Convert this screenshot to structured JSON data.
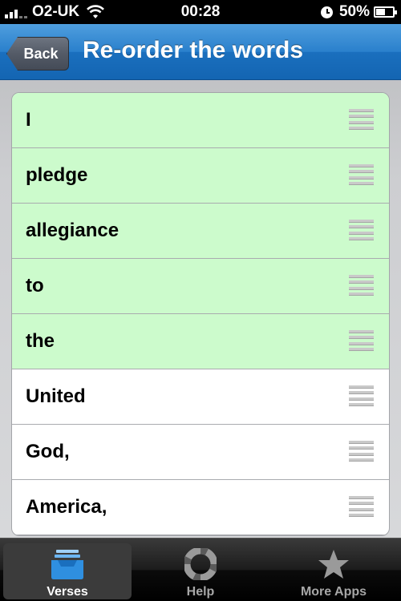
{
  "status_bar": {
    "carrier": "O2-UK",
    "time": "00:28",
    "battery": "50%"
  },
  "nav_bar": {
    "back_label": "Back",
    "title": "Re-order the words"
  },
  "words": [
    {
      "text": "I",
      "correct": true
    },
    {
      "text": "pledge",
      "correct": true
    },
    {
      "text": "allegiance",
      "correct": true
    },
    {
      "text": "to",
      "correct": true
    },
    {
      "text": "the",
      "correct": true
    },
    {
      "text": "United",
      "correct": false
    },
    {
      "text": "God,",
      "correct": false
    },
    {
      "text": "America,",
      "correct": false
    }
  ],
  "tab_bar": {
    "tabs": [
      {
        "label": "Verses",
        "icon": "inbox-tray-icon",
        "active": true
      },
      {
        "label": "Help",
        "icon": "lifebuoy-icon",
        "active": false
      },
      {
        "label": "More Apps",
        "icon": "star-icon",
        "active": false
      }
    ]
  },
  "colors": {
    "correct_row": "#ccfbcc",
    "nav_blue": "#2a80cc",
    "verses_icon_blue": "#2f8fe0"
  }
}
